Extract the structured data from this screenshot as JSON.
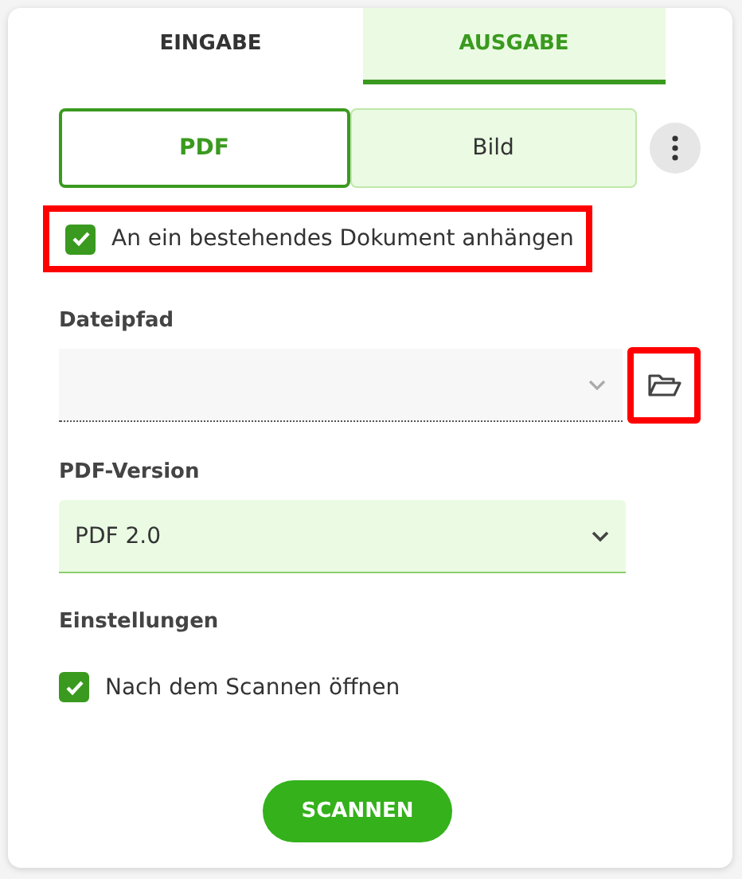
{
  "tabs": [
    {
      "label": "EINGABE",
      "selected": false
    },
    {
      "label": "AUSGABE",
      "selected": true
    }
  ],
  "format": {
    "options": [
      {
        "label": "PDF",
        "selected": true
      },
      {
        "label": "Bild",
        "selected": false
      }
    ]
  },
  "append_option": {
    "label": "An ein bestehendes Dokument anhängen",
    "checked": true,
    "highlighted": true
  },
  "file_path": {
    "label": "Dateipfad",
    "browse_highlighted": true
  },
  "pdf_version": {
    "label": "PDF-Version",
    "value": "PDF 2.0"
  },
  "settings": {
    "label": "Einstellungen",
    "options": [
      {
        "label": "Nach dem Scannen öffnen",
        "checked": true
      }
    ]
  },
  "scan_button": "SCANNEN"
}
